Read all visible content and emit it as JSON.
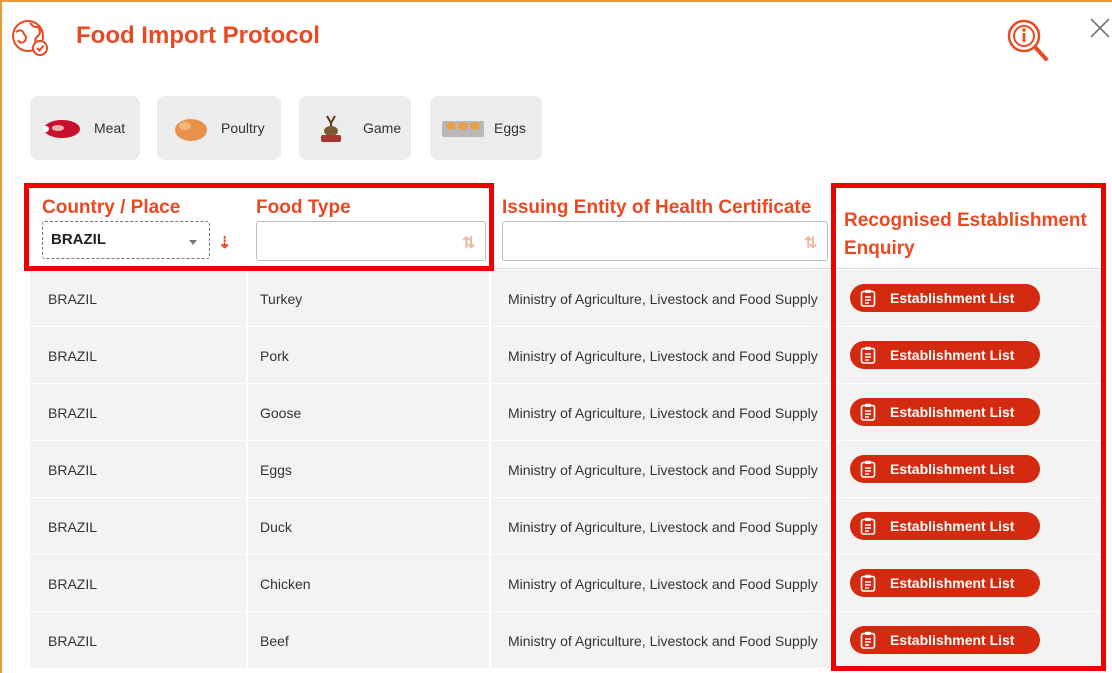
{
  "header": {
    "title": "Food Import Protocol"
  },
  "categories": [
    {
      "label": "Meat",
      "icon": "meat-icon"
    },
    {
      "label": "Poultry",
      "icon": "poultry-icon"
    },
    {
      "label": "Game",
      "icon": "game-icon"
    },
    {
      "label": "Eggs",
      "icon": "eggs-icon"
    }
  ],
  "table": {
    "headers": {
      "country": "Country / Place",
      "food_type": "Food Type",
      "issuer": "Issuing Entity of Health Certificate",
      "establishment": "Recognised Establishment Enquiry"
    },
    "country_filter": "BRAZIL",
    "rows": [
      {
        "country": "BRAZIL",
        "food": "Turkey",
        "issuer": "Ministry of Agriculture, Livestock and Food Supply",
        "button": "Establishment List"
      },
      {
        "country": "BRAZIL",
        "food": "Pork",
        "issuer": "Ministry of Agriculture, Livestock and Food Supply",
        "button": "Establishment List"
      },
      {
        "country": "BRAZIL",
        "food": "Goose",
        "issuer": "Ministry of Agriculture, Livestock and Food Supply",
        "button": "Establishment List"
      },
      {
        "country": "BRAZIL",
        "food": "Eggs",
        "issuer": "Ministry of Agriculture, Livestock and Food Supply",
        "button": "Establishment List"
      },
      {
        "country": "BRAZIL",
        "food": "Duck",
        "issuer": "Ministry of Agriculture, Livestock and Food Supply",
        "button": "Establishment List"
      },
      {
        "country": "BRAZIL",
        "food": "Chicken",
        "issuer": "Ministry of Agriculture, Livestock and Food Supply",
        "button": "Establishment List"
      },
      {
        "country": "BRAZIL",
        "food": "Beef",
        "issuer": "Ministry of Agriculture, Livestock and Food Supply",
        "button": "Establishment List"
      }
    ]
  },
  "colors": {
    "accent": "#e84a23",
    "button": "#d42a10",
    "highlight": "#ee0000",
    "frame": "#e89a3c"
  }
}
